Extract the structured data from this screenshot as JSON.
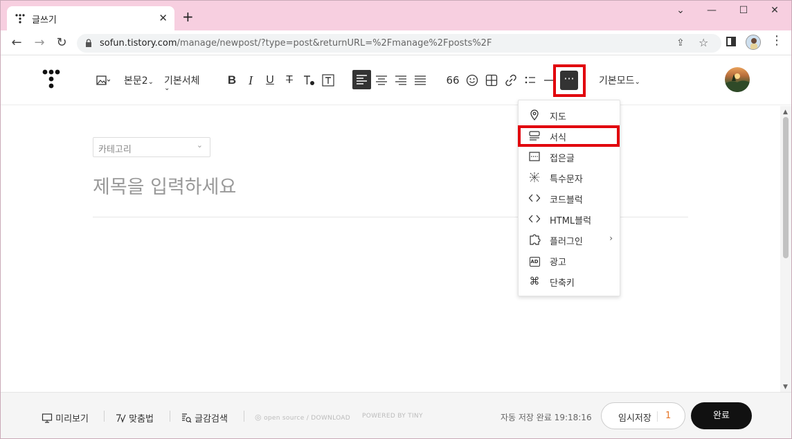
{
  "browser": {
    "tab_title": "글쓰기",
    "tab_close": "✕",
    "new_tab": "+",
    "url_host": "sofun.tistory.com",
    "url_path": "/manage/newpost/?type=post&returnURL=%2Fmanage%2Fposts%2F",
    "window_controls": {
      "chevron": "⌄",
      "minimize": "—",
      "maximize": "☐",
      "close": "✕"
    },
    "nav": {
      "back": "←",
      "forward": "→",
      "reload": "↻"
    },
    "omni_icons": {
      "share": "⇪",
      "star": "☆"
    },
    "menu": "⋮"
  },
  "toolbar": {
    "paragraph_style": "본문2",
    "font_family": "기본서체",
    "quote": "66",
    "more": "···",
    "mode": "기본모드"
  },
  "editor": {
    "category_placeholder": "카테고리",
    "title_placeholder": "제목을 입력하세요"
  },
  "dropdown": {
    "items": [
      {
        "label": "지도",
        "icon": "map-pin-icon"
      },
      {
        "label": "서식",
        "icon": "template-icon"
      },
      {
        "label": "접은글",
        "icon": "fold-icon"
      },
      {
        "label": "특수문자",
        "icon": "special-char-icon"
      },
      {
        "label": "코드블럭",
        "icon": "code-icon"
      },
      {
        "label": "HTML블럭",
        "icon": "html-icon"
      },
      {
        "label": "플러그인",
        "icon": "plugin-icon"
      },
      {
        "label": "광고",
        "icon": "ad-icon"
      },
      {
        "label": "단축키",
        "icon": "command-icon"
      }
    ],
    "plugin_arrow": "›",
    "ad_badge": "AD"
  },
  "footer": {
    "preview": "미리보기",
    "spellcheck": "맞춤법",
    "search": "글감검색",
    "open_source": "open source / DOWNLOAD",
    "powered": "POWERED BY TINY",
    "autosave": "자동 저장 완료 19:18:16",
    "temp_save": "임시저장",
    "temp_count": "1",
    "done": "완료"
  },
  "colors": {
    "tab_bar": "#f7cfe0",
    "highlight_red": "#e1000a",
    "dark_button": "#333333",
    "temp_count": "#e6782a"
  }
}
